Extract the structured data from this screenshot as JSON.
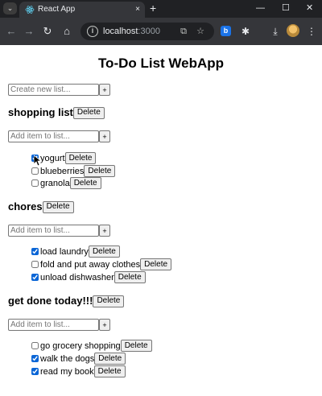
{
  "browser": {
    "tab_title": "React App",
    "tab_close": "×",
    "new_tab": "+",
    "window_controls": {
      "minimize": "—",
      "maximize": "☐",
      "close": "✕"
    },
    "address": {
      "host": "localhost",
      "port": ":3000"
    }
  },
  "app": {
    "title": "To-Do List WebApp",
    "new_list": {
      "placeholder": "Create new list...",
      "add_label": "+"
    },
    "lists": [
      {
        "name": "shopping list",
        "delete_label": "Delete",
        "add_item": {
          "placeholder": "Add item to list...",
          "add_label": "+"
        },
        "items": [
          {
            "label": "yogurt",
            "checked": true,
            "delete_label": "Delete"
          },
          {
            "label": "blueberries",
            "checked": false,
            "delete_label": "Delete"
          },
          {
            "label": "granola",
            "checked": false,
            "delete_label": "Delete"
          }
        ]
      },
      {
        "name": "chores",
        "delete_label": "Delete",
        "add_item": {
          "placeholder": "Add item to list...",
          "add_label": "+"
        },
        "items": [
          {
            "label": "load laundry",
            "checked": true,
            "delete_label": "Delete"
          },
          {
            "label": "fold and put away clothes",
            "checked": false,
            "delete_label": "Delete"
          },
          {
            "label": "unload dishwasher",
            "checked": true,
            "delete_label": "Delete"
          }
        ]
      },
      {
        "name": "get done today!!!",
        "delete_label": "Delete",
        "add_item": {
          "placeholder": "Add item to list...",
          "add_label": "+"
        },
        "items": [
          {
            "label": "go grocery shopping",
            "checked": false,
            "delete_label": "Delete"
          },
          {
            "label": "walk the dogs",
            "checked": true,
            "delete_label": "Delete"
          },
          {
            "label": "read my book",
            "checked": true,
            "delete_label": "Delete"
          }
        ]
      }
    ]
  },
  "colors": {
    "chrome_dark": "#202124",
    "chrome_toolbar": "#35363a",
    "checkbox_accent": "#0b66d6",
    "page_bg": "#ffffff"
  }
}
